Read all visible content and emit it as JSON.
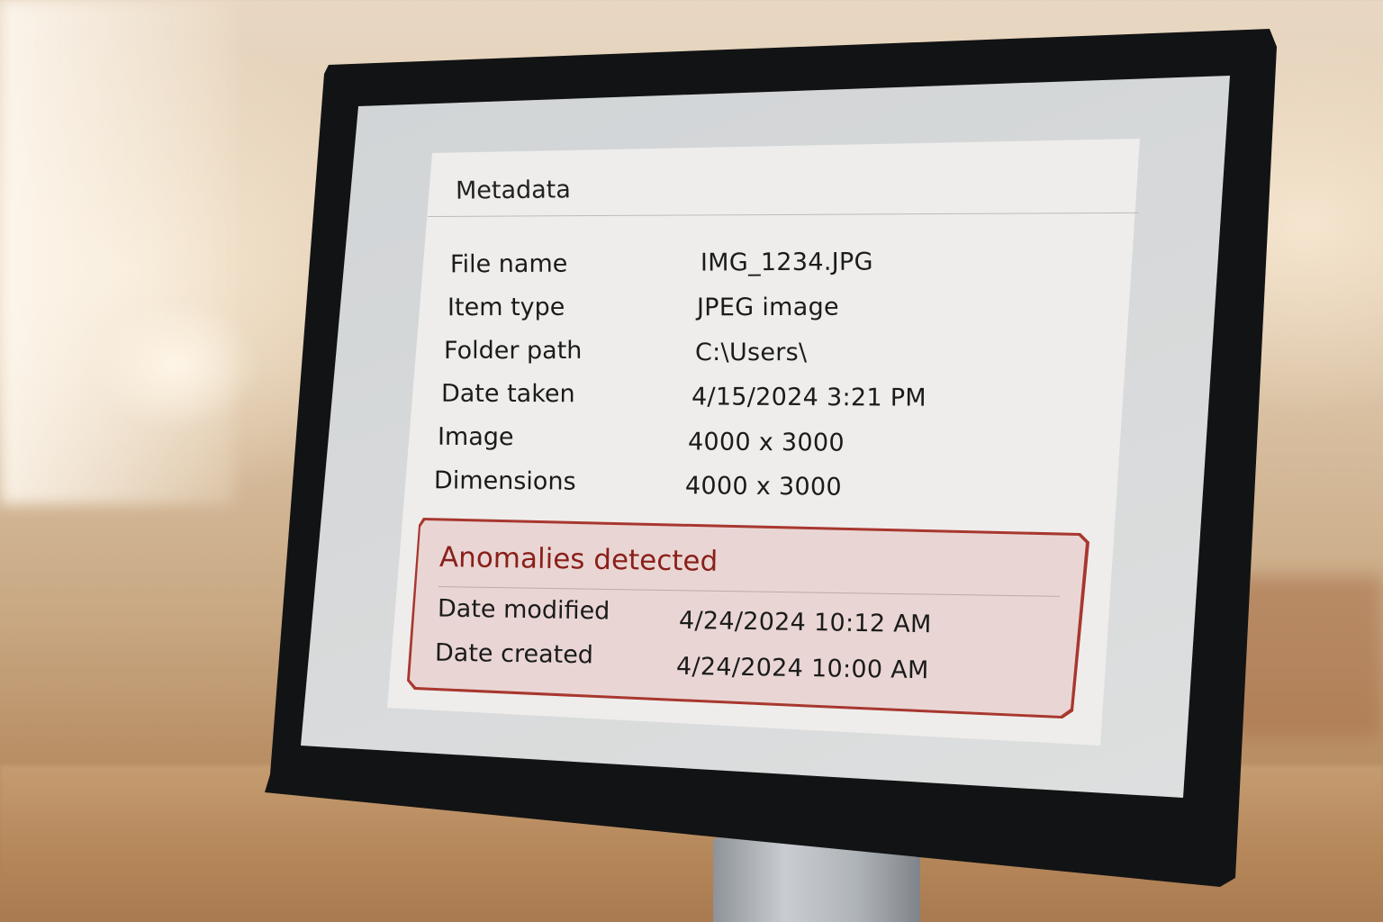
{
  "panel": {
    "title": "Metadata"
  },
  "rows": [
    {
      "label": "File name",
      "value": "IMG_1234.JPG"
    },
    {
      "label": "Item type",
      "value": "JPEG image"
    },
    {
      "label": "Folder path",
      "value": "C:\\Users\\"
    },
    {
      "label": "Date taken",
      "value": "4/15/2024 3:21 PM"
    },
    {
      "label": "Image",
      "value": "4000 x 3000"
    },
    {
      "label": "Dimensions",
      "value": "4000 x 3000"
    }
  ],
  "anomalies": {
    "title": "Anomalies detected",
    "rows": [
      {
        "label": "Date modified",
        "value": "4/24/2024 10:12 AM"
      },
      {
        "label": "Date created",
        "value": "4/24/2024 10:00 AM"
      }
    ]
  },
  "colors": {
    "anomaly_border": "#a8372f",
    "anomaly_fill": "#e9d6d4",
    "anomaly_title": "#8a1f1a",
    "panel_fill": "#eeedeb"
  }
}
